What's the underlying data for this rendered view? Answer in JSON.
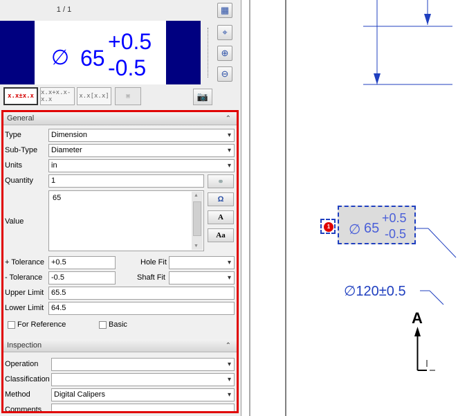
{
  "preview": {
    "page_indicator": "1 / 1",
    "diameter_symbol": "∅",
    "value": "65",
    "plus_tol": "+0.5",
    "minus_tol": "-0.5"
  },
  "toolbar": {
    "btn1": "x.x±x.x",
    "btn2": "x.x+x.x-x.x",
    "btn3": "x.x[x.x]",
    "btn4": "",
    "camera": "camera-icon"
  },
  "general": {
    "title": "General",
    "type_label": "Type",
    "type_value": "Dimension",
    "subtype_label": "Sub-Type",
    "subtype_value": "Diameter",
    "units_label": "Units",
    "units_value": "in",
    "quantity_label": "Quantity",
    "quantity_value": "1",
    "value_label": "Value",
    "value_text": "65",
    "omega": "Ω",
    "font_a": "A",
    "font_aa": "Aa",
    "plus_tol_label": "+ Tolerance",
    "plus_tol_value": "+0.5",
    "minus_tol_label": "- Tolerance",
    "minus_tol_value": "-0.5",
    "hole_fit_label": "Hole Fit",
    "hole_fit_value": "",
    "shaft_fit_label": "Shaft Fit",
    "shaft_fit_value": "",
    "upper_limit_label": "Upper Limit",
    "upper_limit_value": "65.5",
    "lower_limit_label": "Lower Limit",
    "lower_limit_value": "64.5",
    "for_reference_label": "For Reference",
    "basic_label": "Basic"
  },
  "inspection": {
    "title": "Inspection",
    "operation_label": "Operation",
    "operation_value": "",
    "classification_label": "Classification",
    "classification_value": "",
    "method_label": "Method",
    "method_value": "Digital Calipers",
    "comments_label": "Comments"
  },
  "drawing": {
    "balloon_number": "1",
    "dim_diameter_symbol": "∅",
    "dim_value": "65",
    "dim_plus": "+0.5",
    "dim_minus": "-0.5",
    "dim120_symbol": "∅",
    "dim120_text": "120±0.5",
    "section_letter": "A"
  },
  "colors": {
    "accent_red": "#e00000",
    "preview_bg": "#000080",
    "dimension_blue": "#1f3fbf"
  }
}
